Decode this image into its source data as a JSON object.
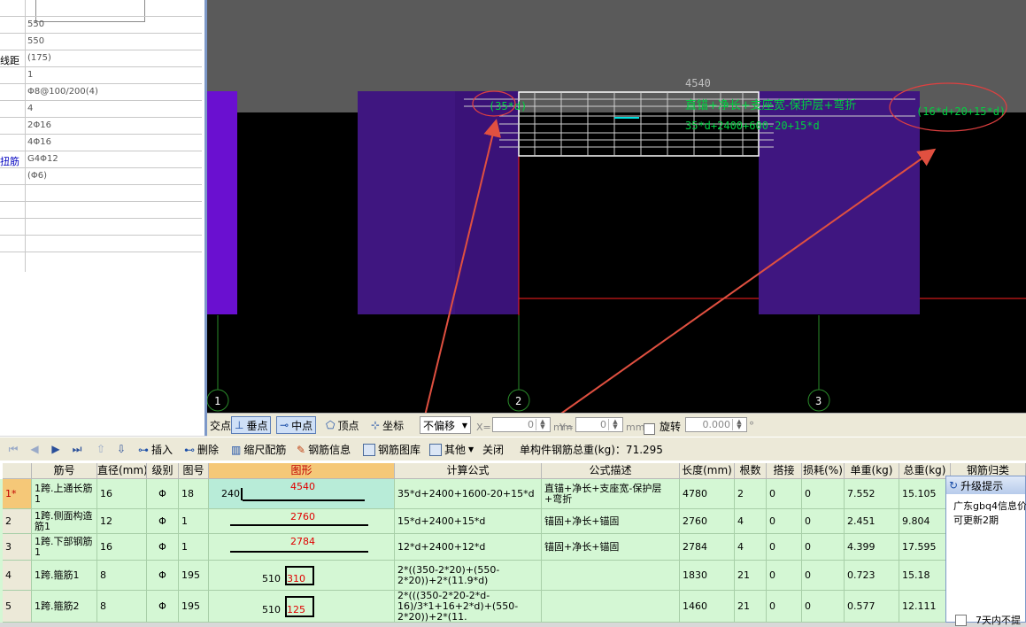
{
  "properties": {
    "rows": [
      {
        "name": "",
        "value": ""
      },
      {
        "name": "",
        "value": "550"
      },
      {
        "name": "",
        "value": "550"
      },
      {
        "name": "线距",
        "value": "(175)"
      },
      {
        "name": "",
        "value": "1"
      },
      {
        "name": "",
        "value": "Φ8@100/200(4)"
      },
      {
        "name": "",
        "value": "4"
      },
      {
        "name": "",
        "value": "2Φ16"
      },
      {
        "name": "",
        "value": "4Φ16"
      },
      {
        "name": "扭筋",
        "value": "G4Φ12"
      },
      {
        "name": "",
        "value": "(Φ6)"
      },
      {
        "name": "",
        "value": ""
      },
      {
        "name": "",
        "value": ""
      },
      {
        "name": "",
        "value": ""
      },
      {
        "name": "",
        "value": ""
      }
    ]
  },
  "cad": {
    "dimension": "4540",
    "annotation_left": "(35*d)",
    "annotation_right": "(16*d+20+15*d)",
    "annotation_right_short": "",
    "annotation_desc": "直锚+净长+支座宽-保护层+弯折",
    "annotation_formula": "35*d+2400+600-20+15*d",
    "axis_labels": [
      "1",
      "2",
      "3"
    ],
    "colors": {
      "column": "#4a1a8a",
      "column_bright": "#6a10d0",
      "beam": "#5a5a5a",
      "annotation": "#00d040",
      "circle": "#e04040",
      "arrow": "#e05040"
    }
  },
  "snapbar": {
    "intersect": "交点",
    "perpendicular": "垂点",
    "midpoint": "中点",
    "vertex": "顶点",
    "coordinate": "坐标",
    "offset": "不偏移",
    "x_label": "X=",
    "x_value": "0",
    "y_label": "Y=",
    "y_value": "0",
    "unit_mm": "mm",
    "rotate": "旋转",
    "rotate_value": "0.000",
    "degree": "°"
  },
  "rebarbar": {
    "insert": "插入",
    "delete": "删除",
    "scale": "缩尺配筋",
    "rebar_info": "钢筋信息",
    "rebar_library": "钢筋图库",
    "other": "其他",
    "close": "关闭",
    "total_weight": "单构件钢筋总重(kg)：71.295"
  },
  "grid": {
    "headers": [
      "筋号",
      "直径(mm)",
      "级别",
      "图号",
      "图形",
      "计算公式",
      "公式描述",
      "长度(mm)",
      "根数",
      "搭接",
      "损耗(%)",
      "单重(kg)",
      "总重(kg)",
      "钢筋归类"
    ],
    "rows": [
      {
        "num": "1*",
        "name": "1跨.上通长筋1",
        "dia": "16",
        "grade": "Φ",
        "fig": "18",
        "shape_left": "240",
        "shape_len": "4540",
        "formula": "35*d+2400+1600-20+15*d",
        "desc": "直锚+净长+支座宽-保护层+弯折",
        "length": "4780",
        "count": "2",
        "lap": "0",
        "loss": "0",
        "unit_w": "7.552",
        "total_w": "15.105"
      },
      {
        "num": "2",
        "name": "1跨.侧面构造筋1",
        "dia": "12",
        "grade": "Φ",
        "fig": "1",
        "shape_left": "",
        "shape_len": "2760",
        "formula": "15*d+2400+15*d",
        "desc": "锚固+净长+锚固",
        "length": "2760",
        "count": "4",
        "lap": "0",
        "loss": "0",
        "unit_w": "2.451",
        "total_w": "9.804"
      },
      {
        "num": "3",
        "name": "1跨.下部钢筋1",
        "dia": "16",
        "grade": "Φ",
        "fig": "1",
        "shape_left": "",
        "shape_len": "2784",
        "formula": "12*d+2400+12*d",
        "desc": "锚固+净长+锚固",
        "length": "2784",
        "count": "4",
        "lap": "0",
        "loss": "0",
        "unit_w": "4.399",
        "total_w": "17.595"
      },
      {
        "num": "4",
        "name": "1跨.箍筋1",
        "dia": "8",
        "grade": "Φ",
        "fig": "195",
        "shape_left": "510",
        "shape_len": "310",
        "formula": "2*((350-2*20)+(550-2*20))+2*(11.9*d)",
        "desc": "",
        "length": "1830",
        "count": "21",
        "lap": "0",
        "loss": "0",
        "unit_w": "0.723",
        "total_w": "15.18"
      },
      {
        "num": "5",
        "name": "1跨.箍筋2",
        "dia": "8",
        "grade": "Φ",
        "fig": "195",
        "shape_left": "510",
        "shape_len": "125",
        "formula": "2*(((350-2*20-2*d-16)/3*1+16+2*d)+(550-2*20))+2*(11.",
        "desc": "",
        "length": "1460",
        "count": "21",
        "lap": "0",
        "loss": "0",
        "unit_w": "0.577",
        "total_w": "12.111"
      }
    ]
  },
  "popup": {
    "title": "升级提示",
    "line1": "广东gbq4信息价",
    "line2": "可更新2期",
    "footer": "7天内不提"
  }
}
